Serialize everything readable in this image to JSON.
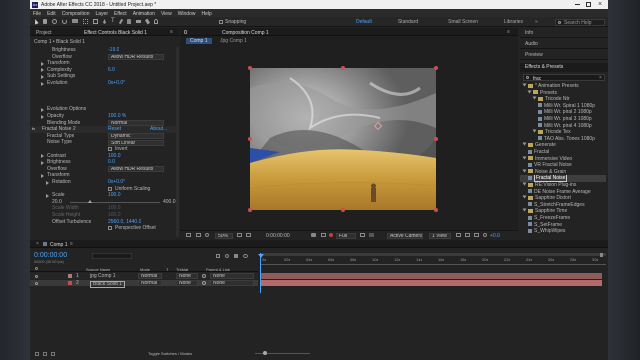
{
  "window": {
    "title": "Adobe After Effects CC 2018 - Untitled Project.aep *"
  },
  "menu": [
    "File",
    "Edit",
    "Composition",
    "Layer",
    "Effect",
    "Animation",
    "View",
    "Window",
    "Help"
  ],
  "toolbar": {
    "snapping": "Snapping",
    "workspaces": [
      "Default",
      "Standard",
      "Small Screen",
      "Libraries"
    ],
    "search_placeholder": "Search Help"
  },
  "left_panel": {
    "tabs": [
      "Project",
      "Effect Controls Black Solid 1"
    ],
    "layer_path": "Comp 1 • Black Solid 1",
    "rows": [
      {
        "label": "Brightness",
        "value": "-19.0",
        "indent": 2
      },
      {
        "label": "Overflow",
        "value": "Allow HDR Results",
        "dd": true,
        "indent": 2
      },
      {
        "label": "Transform",
        "indent": 1,
        "tri": true
      },
      {
        "label": "Complexity",
        "value": "6.0",
        "indent": 1,
        "tri": true
      },
      {
        "label": "Sub Settings",
        "indent": 1,
        "tri": true
      },
      {
        "label": "Evolution",
        "value": "0x+0.0°",
        "indent": 1,
        "tri": true
      },
      {
        "label": "",
        "indent": 1
      },
      {
        "label": "",
        "indent": 1
      },
      {
        "label": "",
        "indent": 1
      },
      {
        "label": "Evolution Options",
        "indent": 1,
        "tri": true
      },
      {
        "label": "Opacity",
        "value": "100.0 %",
        "indent": 1,
        "tri": true
      },
      {
        "label": "Blending Mode",
        "value": "Normal",
        "dd": true,
        "indent": 1
      },
      {
        "label": "Fractal Noise 2",
        "value": "Reset",
        "extra": "About...",
        "indent": 0,
        "fx": true
      },
      {
        "label": "Fractal Type",
        "value": "Dynamic",
        "dd": true,
        "indent": 1
      },
      {
        "label": "Noise Type",
        "value": "Soft Linear",
        "dd": true,
        "indent": 1
      },
      {
        "label": "",
        "value": "Invert",
        "check": true,
        "indent": 1
      },
      {
        "label": "Contrast",
        "value": "100.0",
        "indent": 1,
        "tri": true
      },
      {
        "label": "Brightness",
        "value": "0.0",
        "indent": 1,
        "tri": true
      },
      {
        "label": "Overflow",
        "value": "Allow HDR Results",
        "dd": true,
        "indent": 1
      },
      {
        "label": "Transform",
        "indent": 1,
        "tri": true
      },
      {
        "label": "Rotation",
        "value": "0x+0.0°",
        "indent": 2,
        "tri": true
      },
      {
        "label": "",
        "value": "Uniform Scaling",
        "check": true,
        "indent": 2
      },
      {
        "label": "Scale",
        "value": "100.0",
        "indent": 2,
        "tri": true
      },
      {
        "label": "20.0",
        "value": "400.0",
        "slider": true,
        "indent": 2
      },
      {
        "label": "Scale Width",
        "value": "100.0",
        "indent": 2,
        "dim": true
      },
      {
        "label": "Scale Height",
        "value": "100.0",
        "indent": 2,
        "dim": true
      },
      {
        "label": "Offset Turbulence",
        "value": "2560.0, 1440.0",
        "indent": 2
      },
      {
        "label": "",
        "value": "Perspective Offset",
        "check": true,
        "indent": 2
      }
    ]
  },
  "comp_panel": {
    "tab": "Composition Comp 1",
    "sub_tab": "Comp 1",
    "footer": {
      "zoom": "50%",
      "timecode": "0:00:00:00",
      "resolution": "Full",
      "camera": "Active Camera",
      "views": "1 View",
      "offset": "+0.0"
    }
  },
  "right_panel": {
    "tabs": [
      "Info",
      "Audio",
      "Preview",
      "Effects & Presets"
    ],
    "search_value": "frac",
    "tree": [
      {
        "label": "* Animation Presets",
        "level": 0,
        "type": "folder"
      },
      {
        "label": "Presets",
        "level": 1,
        "type": "folder"
      },
      {
        "label": "Tricode Ntr",
        "level": 2,
        "type": "folder"
      },
      {
        "label": "Milli Wr. Spiral 1 1080p",
        "level": 3,
        "type": "file"
      },
      {
        "label": "Milli Wr. piral 2 1080p",
        "level": 3,
        "type": "file"
      },
      {
        "label": "Milli Wr. piral 3 1080p",
        "level": 3,
        "type": "file"
      },
      {
        "label": "Milli Wr. piral 4 1080p",
        "level": 3,
        "type": "file"
      },
      {
        "label": "Tricode Tex",
        "level": 2,
        "type": "folder"
      },
      {
        "label": "TAO Abs. Tones 1080p",
        "level": 3,
        "type": "file"
      },
      {
        "label": "Generate",
        "level": 0,
        "type": "folder"
      },
      {
        "label": "Fractal",
        "level": 1,
        "type": "file"
      },
      {
        "label": "Immersive Video",
        "level": 0,
        "type": "folder"
      },
      {
        "label": "VR Fractal Noise",
        "level": 1,
        "type": "file"
      },
      {
        "label": "Noise & Grain",
        "level": 0,
        "type": "folder"
      },
      {
        "label": "Fractal Noise",
        "level": 1,
        "type": "file",
        "selected": true
      },
      {
        "label": "RE:Vision Plug-ins",
        "level": 0,
        "type": "folder"
      },
      {
        "label": "DE Noise Frame Average",
        "level": 1,
        "type": "file"
      },
      {
        "label": "Sapphire Distort",
        "level": 0,
        "type": "folder"
      },
      {
        "label": "S_StretchFrameEdges",
        "level": 1,
        "type": "file"
      },
      {
        "label": "Sapphire Time",
        "level": 0,
        "type": "folder"
      },
      {
        "label": "S_FreezeFrame",
        "level": 1,
        "type": "file"
      },
      {
        "label": "S_SetFrame",
        "level": 1,
        "type": "file"
      },
      {
        "label": "S_WhipWipes",
        "level": 1,
        "type": "file"
      }
    ]
  },
  "timeline": {
    "tab": "Comp 1",
    "timecode": "0:00:00:00",
    "fps": "00000 (30.00 fps)",
    "columns": [
      "Source Name",
      "Mode",
      "T",
      "TrkMat",
      "Parent & Link"
    ],
    "layers": [
      {
        "num": "1",
        "name": "jpg Comp 1",
        "mode": "Normal",
        "trkmat": "None",
        "parent": "None"
      },
      {
        "num": "2",
        "name": "Black Solid 1",
        "mode": "Normal",
        "trkmat": "None",
        "parent": "None"
      }
    ],
    "ruler": [
      "0s",
      "02s",
      "04s",
      "06s",
      "08s",
      "10s",
      "12s",
      "14s",
      "16s",
      "18s",
      "20s",
      "22s",
      "24s",
      "26s",
      "28s",
      "30s"
    ],
    "footer": "Toggle Switches / Modes"
  }
}
